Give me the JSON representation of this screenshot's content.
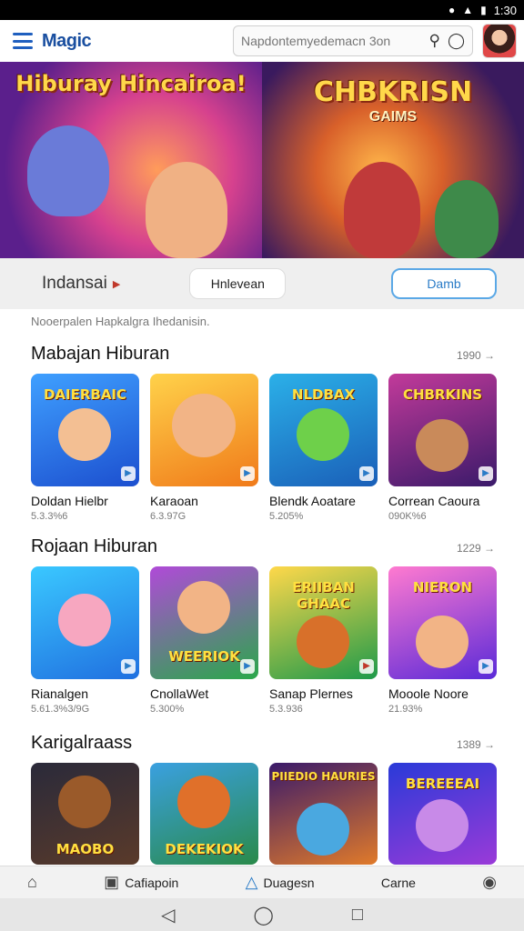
{
  "status": {
    "time": "1:30"
  },
  "header": {
    "logo": "Magic",
    "search_placeholder": "Napdontemyedemacn 3on"
  },
  "banner": {
    "left_title": "Hiburay Hincairoa!",
    "right_title": "CHBKRISN",
    "right_sub": "GAIMS"
  },
  "filter": {
    "region": "Indansai",
    "pill_1": "Hnlevean",
    "pill_2": "Damb"
  },
  "note": "Nooerpalen Hapkalgra Ihedanisin.",
  "sections": [
    {
      "title": "Mabajan Hiburan",
      "more": "1990 →",
      "items": [
        {
          "title": "Doldan Hielbr",
          "meta": "5.3.3%6",
          "thumb_text": "DAIERBAIC"
        },
        {
          "title": "Karaoan",
          "meta": "6.3.97G",
          "thumb_text": ""
        },
        {
          "title": "Blendk Aoatare",
          "meta": "5.205%",
          "thumb_text": "NLDBAX"
        },
        {
          "title": "Correan Caoura",
          "meta": "090K%6",
          "thumb_text": "CHBRKINS"
        }
      ]
    },
    {
      "title": "Rojaan Hiburan",
      "more": "1229 →",
      "items": [
        {
          "title": "Rianalgen",
          "meta": "5.61.3%3/9G",
          "thumb_text": ""
        },
        {
          "title": "CnollaWet",
          "meta": "5.300%",
          "thumb_text": "WEERIOK"
        },
        {
          "title": "Sanap Plernes",
          "meta": "5.3.936",
          "thumb_text": "ERIIBAN GHAAC"
        },
        {
          "title": "Mooole Noore",
          "meta": "21.93%",
          "thumb_text": "NIERON"
        }
      ]
    },
    {
      "title": "Karigalraass",
      "more": "1389 →",
      "items": [
        {
          "title": "",
          "meta": "",
          "thumb_text": "MAOBO"
        },
        {
          "title": "",
          "meta": "",
          "thumb_text": "DEKEKIOK"
        },
        {
          "title": "",
          "meta": "",
          "thumb_text": "PIIEDIO HAURIES"
        },
        {
          "title": "",
          "meta": "",
          "thumb_text": "BEREEEAI"
        }
      ]
    }
  ],
  "bottom_nav": {
    "item_2": "Cafiapoin",
    "item_3": "Duagesn",
    "item_4": "Carne"
  },
  "colors": {
    "accent": "#2b7cc7",
    "region_caret": "#c0392b"
  }
}
